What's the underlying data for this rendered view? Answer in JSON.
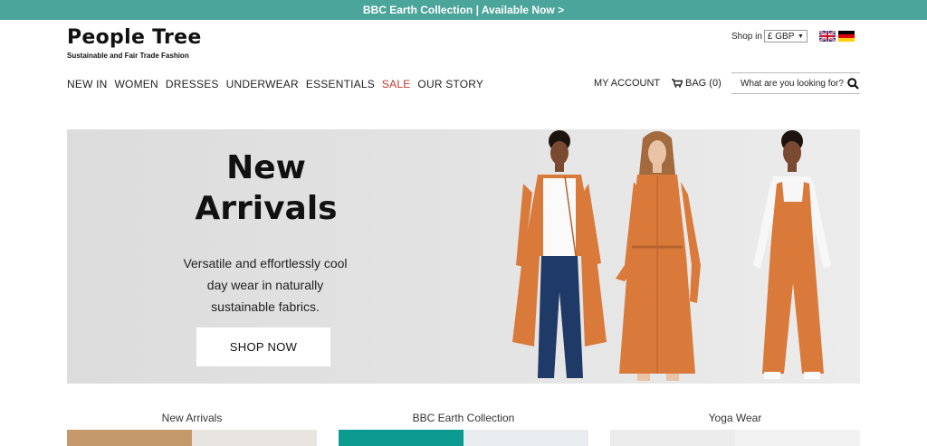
{
  "announcement": "BBC Earth Collection | Available Now >",
  "brand": {
    "name": "People Tree",
    "tagline": "Sustainable and Fair Trade Fashion"
  },
  "currency": {
    "label": "Shop in",
    "selected": "£ GBP"
  },
  "flags": [
    "flag-uk-icon",
    "flag-de-icon"
  ],
  "nav": {
    "items": [
      {
        "label": "NEW IN"
      },
      {
        "label": "WOMEN"
      },
      {
        "label": "DRESSES"
      },
      {
        "label": "UNDERWEAR"
      },
      {
        "label": "ESSENTIALS"
      },
      {
        "label": "SALE"
      },
      {
        "label": "OUR STORY"
      }
    ],
    "sale_color": "#c0392b"
  },
  "account": {
    "label": "MY ACCOUNT"
  },
  "bag": {
    "label": "BAG (0)"
  },
  "search": {
    "placeholder": "What are you looking for?"
  },
  "hero": {
    "title_line1": "New",
    "title_line2": "Arrivals",
    "text": "Versatile and effortlessly cool day wear in naturally sustainable fabrics.",
    "cta": "SHOP NOW"
  },
  "categories": [
    {
      "label": "New Arrivals"
    },
    {
      "label": "BBC Earth Collection"
    },
    {
      "label": "Yoga Wear"
    }
  ],
  "colors": {
    "accent": "#4ba59a",
    "orange": "#d9793a",
    "denim": "#1f3a66"
  }
}
